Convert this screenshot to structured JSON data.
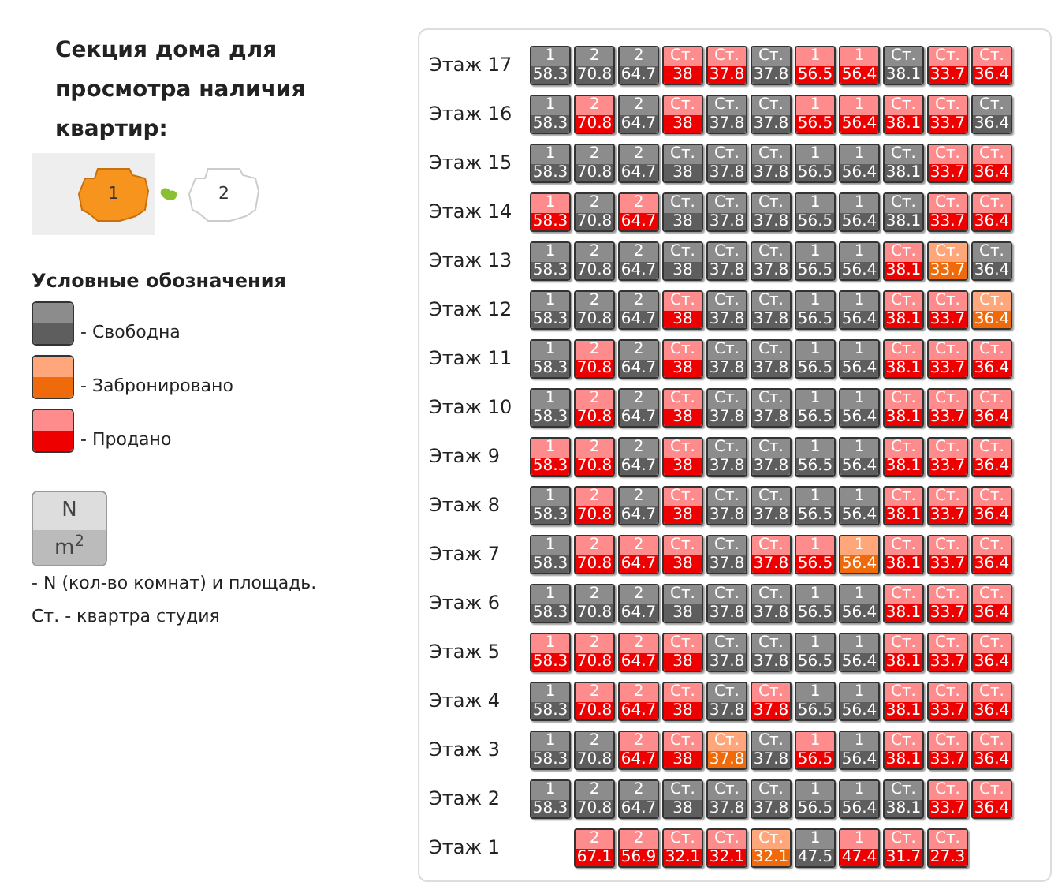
{
  "sidebar": {
    "title": "Секция дома для просмотра наличия квартир:",
    "sections": [
      {
        "label": "1",
        "selected": true
      },
      {
        "label": "2",
        "selected": false
      }
    ],
    "legend_title": "Условные обозначения",
    "legend": [
      {
        "kind": "free",
        "label": "- Свободна"
      },
      {
        "kind": "reserved",
        "label": "- Забронировано"
      },
      {
        "kind": "sold",
        "label": "- Продано"
      }
    ],
    "sample": {
      "top": "N",
      "bottom": "m$^{2}$",
      "label": "- N (кол-во комнат) и площадь."
    },
    "note": "Ст. - квартра студия"
  },
  "floors": [
    {
      "label": "Этаж 17",
      "indented": false,
      "cells": [
        {
          "rooms": "1",
          "area": "58.3",
          "kind": "free"
        },
        {
          "rooms": "2",
          "area": "70.8",
          "kind": "free"
        },
        {
          "rooms": "2",
          "area": "64.7",
          "kind": "free"
        },
        {
          "rooms": "Ст.",
          "area": "38",
          "kind": "sold"
        },
        {
          "rooms": "Ст.",
          "area": "37.8",
          "kind": "sold"
        },
        {
          "rooms": "Ст.",
          "area": "37.8",
          "kind": "free"
        },
        {
          "rooms": "1",
          "area": "56.5",
          "kind": "sold"
        },
        {
          "rooms": "1",
          "area": "56.4",
          "kind": "sold"
        },
        {
          "rooms": "Ст.",
          "area": "38.1",
          "kind": "free"
        },
        {
          "rooms": "Ст.",
          "area": "33.7",
          "kind": "sold"
        },
        {
          "rooms": "Ст.",
          "area": "36.4",
          "kind": "sold"
        }
      ]
    },
    {
      "label": "Этаж 16",
      "indented": false,
      "cells": [
        {
          "rooms": "1",
          "area": "58.3",
          "kind": "free"
        },
        {
          "rooms": "2",
          "area": "70.8",
          "kind": "sold"
        },
        {
          "rooms": "2",
          "area": "64.7",
          "kind": "free"
        },
        {
          "rooms": "Ст.",
          "area": "38",
          "kind": "sold"
        },
        {
          "rooms": "Ст.",
          "area": "37.8",
          "kind": "free"
        },
        {
          "rooms": "Ст.",
          "area": "37.8",
          "kind": "free"
        },
        {
          "rooms": "1",
          "area": "56.5",
          "kind": "sold"
        },
        {
          "rooms": "1",
          "area": "56.4",
          "kind": "sold"
        },
        {
          "rooms": "Ст.",
          "area": "38.1",
          "kind": "sold"
        },
        {
          "rooms": "Ст.",
          "area": "33.7",
          "kind": "sold"
        },
        {
          "rooms": "Ст.",
          "area": "36.4",
          "kind": "free"
        }
      ]
    },
    {
      "label": "Этаж 15",
      "indented": false,
      "cells": [
        {
          "rooms": "1",
          "area": "58.3",
          "kind": "free"
        },
        {
          "rooms": "2",
          "area": "70.8",
          "kind": "free"
        },
        {
          "rooms": "2",
          "area": "64.7",
          "kind": "free"
        },
        {
          "rooms": "Ст.",
          "area": "38",
          "kind": "free"
        },
        {
          "rooms": "Ст.",
          "area": "37.8",
          "kind": "free"
        },
        {
          "rooms": "Ст.",
          "area": "37.8",
          "kind": "free"
        },
        {
          "rooms": "1",
          "area": "56.5",
          "kind": "free"
        },
        {
          "rooms": "1",
          "area": "56.4",
          "kind": "free"
        },
        {
          "rooms": "Ст.",
          "area": "38.1",
          "kind": "free"
        },
        {
          "rooms": "Ст.",
          "area": "33.7",
          "kind": "sold"
        },
        {
          "rooms": "Ст.",
          "area": "36.4",
          "kind": "sold"
        }
      ]
    },
    {
      "label": "Этаж 14",
      "indented": false,
      "cells": [
        {
          "rooms": "1",
          "area": "58.3",
          "kind": "sold"
        },
        {
          "rooms": "2",
          "area": "70.8",
          "kind": "free"
        },
        {
          "rooms": "2",
          "area": "64.7",
          "kind": "sold"
        },
        {
          "rooms": "Ст.",
          "area": "38",
          "kind": "free"
        },
        {
          "rooms": "Ст.",
          "area": "37.8",
          "kind": "free"
        },
        {
          "rooms": "Ст.",
          "area": "37.8",
          "kind": "free"
        },
        {
          "rooms": "1",
          "area": "56.5",
          "kind": "free"
        },
        {
          "rooms": "1",
          "area": "56.4",
          "kind": "free"
        },
        {
          "rooms": "Ст.",
          "area": "38.1",
          "kind": "free"
        },
        {
          "rooms": "Ст.",
          "area": "33.7",
          "kind": "sold"
        },
        {
          "rooms": "Ст.",
          "area": "36.4",
          "kind": "sold"
        }
      ]
    },
    {
      "label": "Этаж 13",
      "indented": false,
      "cells": [
        {
          "rooms": "1",
          "area": "58.3",
          "kind": "free"
        },
        {
          "rooms": "2",
          "area": "70.8",
          "kind": "free"
        },
        {
          "rooms": "2",
          "area": "64.7",
          "kind": "free"
        },
        {
          "rooms": "Ст.",
          "area": "38",
          "kind": "free"
        },
        {
          "rooms": "Ст.",
          "area": "37.8",
          "kind": "free"
        },
        {
          "rooms": "Ст.",
          "area": "37.8",
          "kind": "free"
        },
        {
          "rooms": "1",
          "area": "56.5",
          "kind": "free"
        },
        {
          "rooms": "1",
          "area": "56.4",
          "kind": "free"
        },
        {
          "rooms": "Ст.",
          "area": "38.1",
          "kind": "sold"
        },
        {
          "rooms": "Ст.",
          "area": "33.7",
          "kind": "reserved"
        },
        {
          "rooms": "Ст.",
          "area": "36.4",
          "kind": "free"
        }
      ]
    },
    {
      "label": "Этаж 12",
      "indented": false,
      "cells": [
        {
          "rooms": "1",
          "area": "58.3",
          "kind": "free"
        },
        {
          "rooms": "2",
          "area": "70.8",
          "kind": "free"
        },
        {
          "rooms": "2",
          "area": "64.7",
          "kind": "free"
        },
        {
          "rooms": "Ст.",
          "area": "38",
          "kind": "sold"
        },
        {
          "rooms": "Ст.",
          "area": "37.8",
          "kind": "free"
        },
        {
          "rooms": "Ст.",
          "area": "37.8",
          "kind": "free"
        },
        {
          "rooms": "1",
          "area": "56.5",
          "kind": "free"
        },
        {
          "rooms": "1",
          "area": "56.4",
          "kind": "free"
        },
        {
          "rooms": "Ст.",
          "area": "38.1",
          "kind": "sold"
        },
        {
          "rooms": "Ст.",
          "area": "33.7",
          "kind": "sold"
        },
        {
          "rooms": "Ст.",
          "area": "36.4",
          "kind": "reserved"
        }
      ]
    },
    {
      "label": "Этаж 11",
      "indented": false,
      "cells": [
        {
          "rooms": "1",
          "area": "58.3",
          "kind": "free"
        },
        {
          "rooms": "2",
          "area": "70.8",
          "kind": "sold"
        },
        {
          "rooms": "2",
          "area": "64.7",
          "kind": "free"
        },
        {
          "rooms": "Ст.",
          "area": "38",
          "kind": "sold"
        },
        {
          "rooms": "Ст.",
          "area": "37.8",
          "kind": "free"
        },
        {
          "rooms": "Ст.",
          "area": "37.8",
          "kind": "free"
        },
        {
          "rooms": "1",
          "area": "56.5",
          "kind": "free"
        },
        {
          "rooms": "1",
          "area": "56.4",
          "kind": "free"
        },
        {
          "rooms": "Ст.",
          "area": "38.1",
          "kind": "sold"
        },
        {
          "rooms": "Ст.",
          "area": "33.7",
          "kind": "sold"
        },
        {
          "rooms": "Ст.",
          "area": "36.4",
          "kind": "sold"
        }
      ]
    },
    {
      "label": "Этаж 10",
      "indented": false,
      "cells": [
        {
          "rooms": "1",
          "area": "58.3",
          "kind": "free"
        },
        {
          "rooms": "2",
          "area": "70.8",
          "kind": "sold"
        },
        {
          "rooms": "2",
          "area": "64.7",
          "kind": "free"
        },
        {
          "rooms": "Ст.",
          "area": "38",
          "kind": "sold"
        },
        {
          "rooms": "Ст.",
          "area": "37.8",
          "kind": "free"
        },
        {
          "rooms": "Ст.",
          "area": "37.8",
          "kind": "free"
        },
        {
          "rooms": "1",
          "area": "56.5",
          "kind": "free"
        },
        {
          "rooms": "1",
          "area": "56.4",
          "kind": "free"
        },
        {
          "rooms": "Ст.",
          "area": "38.1",
          "kind": "sold"
        },
        {
          "rooms": "Ст.",
          "area": "33.7",
          "kind": "sold"
        },
        {
          "rooms": "Ст.",
          "area": "36.4",
          "kind": "sold"
        }
      ]
    },
    {
      "label": "Этаж 9",
      "indented": false,
      "cells": [
        {
          "rooms": "1",
          "area": "58.3",
          "kind": "sold"
        },
        {
          "rooms": "2",
          "area": "70.8",
          "kind": "sold"
        },
        {
          "rooms": "2",
          "area": "64.7",
          "kind": "free"
        },
        {
          "rooms": "Ст.",
          "area": "38",
          "kind": "sold"
        },
        {
          "rooms": "Ст.",
          "area": "37.8",
          "kind": "free"
        },
        {
          "rooms": "Ст.",
          "area": "37.8",
          "kind": "free"
        },
        {
          "rooms": "1",
          "area": "56.5",
          "kind": "free"
        },
        {
          "rooms": "1",
          "area": "56.4",
          "kind": "free"
        },
        {
          "rooms": "Ст.",
          "area": "38.1",
          "kind": "sold"
        },
        {
          "rooms": "Ст.",
          "area": "33.7",
          "kind": "sold"
        },
        {
          "rooms": "Ст.",
          "area": "36.4",
          "kind": "sold"
        }
      ]
    },
    {
      "label": "Этаж 8",
      "indented": false,
      "cells": [
        {
          "rooms": "1",
          "area": "58.3",
          "kind": "free"
        },
        {
          "rooms": "2",
          "area": "70.8",
          "kind": "sold"
        },
        {
          "rooms": "2",
          "area": "64.7",
          "kind": "free"
        },
        {
          "rooms": "Ст.",
          "area": "38",
          "kind": "sold"
        },
        {
          "rooms": "Ст.",
          "area": "37.8",
          "kind": "free"
        },
        {
          "rooms": "Ст.",
          "area": "37.8",
          "kind": "free"
        },
        {
          "rooms": "1",
          "area": "56.5",
          "kind": "free"
        },
        {
          "rooms": "1",
          "area": "56.4",
          "kind": "free"
        },
        {
          "rooms": "Ст.",
          "area": "38.1",
          "kind": "sold"
        },
        {
          "rooms": "Ст.",
          "area": "33.7",
          "kind": "sold"
        },
        {
          "rooms": "Ст.",
          "area": "36.4",
          "kind": "sold"
        }
      ]
    },
    {
      "label": "Этаж 7",
      "indented": false,
      "cells": [
        {
          "rooms": "1",
          "area": "58.3",
          "kind": "free"
        },
        {
          "rooms": "2",
          "area": "70.8",
          "kind": "sold"
        },
        {
          "rooms": "2",
          "area": "64.7",
          "kind": "sold"
        },
        {
          "rooms": "Ст.",
          "area": "38",
          "kind": "sold"
        },
        {
          "rooms": "Ст.",
          "area": "37.8",
          "kind": "free"
        },
        {
          "rooms": "Ст.",
          "area": "37.8",
          "kind": "sold"
        },
        {
          "rooms": "1",
          "area": "56.5",
          "kind": "sold"
        },
        {
          "rooms": "1",
          "area": "56.4",
          "kind": "reserved"
        },
        {
          "rooms": "Ст.",
          "area": "38.1",
          "kind": "sold"
        },
        {
          "rooms": "Ст.",
          "area": "33.7",
          "kind": "sold"
        },
        {
          "rooms": "Ст.",
          "area": "36.4",
          "kind": "sold"
        }
      ]
    },
    {
      "label": "Этаж 6",
      "indented": false,
      "cells": [
        {
          "rooms": "1",
          "area": "58.3",
          "kind": "free"
        },
        {
          "rooms": "2",
          "area": "70.8",
          "kind": "free"
        },
        {
          "rooms": "2",
          "area": "64.7",
          "kind": "free"
        },
        {
          "rooms": "Ст.",
          "area": "38",
          "kind": "free"
        },
        {
          "rooms": "Ст.",
          "area": "37.8",
          "kind": "free"
        },
        {
          "rooms": "Ст.",
          "area": "37.8",
          "kind": "free"
        },
        {
          "rooms": "1",
          "area": "56.5",
          "kind": "free"
        },
        {
          "rooms": "1",
          "area": "56.4",
          "kind": "free"
        },
        {
          "rooms": "Ст.",
          "area": "38.1",
          "kind": "sold"
        },
        {
          "rooms": "Ст.",
          "area": "33.7",
          "kind": "sold"
        },
        {
          "rooms": "Ст.",
          "area": "36.4",
          "kind": "sold"
        }
      ]
    },
    {
      "label": "Этаж 5",
      "indented": false,
      "cells": [
        {
          "rooms": "1",
          "area": "58.3",
          "kind": "sold"
        },
        {
          "rooms": "2",
          "area": "70.8",
          "kind": "sold"
        },
        {
          "rooms": "2",
          "area": "64.7",
          "kind": "sold"
        },
        {
          "rooms": "Ст.",
          "area": "38",
          "kind": "sold"
        },
        {
          "rooms": "Ст.",
          "area": "37.8",
          "kind": "free"
        },
        {
          "rooms": "Ст.",
          "area": "37.8",
          "kind": "free"
        },
        {
          "rooms": "1",
          "area": "56.5",
          "kind": "free"
        },
        {
          "rooms": "1",
          "area": "56.4",
          "kind": "free"
        },
        {
          "rooms": "Ст.",
          "area": "38.1",
          "kind": "sold"
        },
        {
          "rooms": "Ст.",
          "area": "33.7",
          "kind": "sold"
        },
        {
          "rooms": "Ст.",
          "area": "36.4",
          "kind": "sold"
        }
      ]
    },
    {
      "label": "Этаж 4",
      "indented": false,
      "cells": [
        {
          "rooms": "1",
          "area": "58.3",
          "kind": "free"
        },
        {
          "rooms": "2",
          "area": "70.8",
          "kind": "sold"
        },
        {
          "rooms": "2",
          "area": "64.7",
          "kind": "sold"
        },
        {
          "rooms": "Ст.",
          "area": "38",
          "kind": "sold"
        },
        {
          "rooms": "Ст.",
          "area": "37.8",
          "kind": "free"
        },
        {
          "rooms": "Ст.",
          "area": "37.8",
          "kind": "sold"
        },
        {
          "rooms": "1",
          "area": "56.5",
          "kind": "free"
        },
        {
          "rooms": "1",
          "area": "56.4",
          "kind": "free"
        },
        {
          "rooms": "Ст.",
          "area": "38.1",
          "kind": "sold"
        },
        {
          "rooms": "Ст.",
          "area": "33.7",
          "kind": "sold"
        },
        {
          "rooms": "Ст.",
          "area": "36.4",
          "kind": "sold"
        }
      ]
    },
    {
      "label": "Этаж 3",
      "indented": false,
      "cells": [
        {
          "rooms": "1",
          "area": "58.3",
          "kind": "free"
        },
        {
          "rooms": "2",
          "area": "70.8",
          "kind": "free"
        },
        {
          "rooms": "2",
          "area": "64.7",
          "kind": "sold"
        },
        {
          "rooms": "Ст.",
          "area": "38",
          "kind": "sold"
        },
        {
          "rooms": "Ст.",
          "area": "37.8",
          "kind": "reserved"
        },
        {
          "rooms": "Ст.",
          "area": "37.8",
          "kind": "free"
        },
        {
          "rooms": "1",
          "area": "56.5",
          "kind": "sold"
        },
        {
          "rooms": "1",
          "area": "56.4",
          "kind": "free"
        },
        {
          "rooms": "Ст.",
          "area": "38.1",
          "kind": "sold"
        },
        {
          "rooms": "Ст.",
          "area": "33.7",
          "kind": "sold"
        },
        {
          "rooms": "Ст.",
          "area": "36.4",
          "kind": "sold"
        }
      ]
    },
    {
      "label": "Этаж 2",
      "indented": false,
      "cells": [
        {
          "rooms": "1",
          "area": "58.3",
          "kind": "free"
        },
        {
          "rooms": "2",
          "area": "70.8",
          "kind": "free"
        },
        {
          "rooms": "2",
          "area": "64.7",
          "kind": "free"
        },
        {
          "rooms": "Ст.",
          "area": "38",
          "kind": "free"
        },
        {
          "rooms": "Ст.",
          "area": "37.8",
          "kind": "free"
        },
        {
          "rooms": "Ст.",
          "area": "37.8",
          "kind": "free"
        },
        {
          "rooms": "1",
          "area": "56.5",
          "kind": "free"
        },
        {
          "rooms": "1",
          "area": "56.4",
          "kind": "free"
        },
        {
          "rooms": "Ст.",
          "area": "38.1",
          "kind": "free"
        },
        {
          "rooms": "Ст.",
          "area": "33.7",
          "kind": "sold"
        },
        {
          "rooms": "Ст.",
          "area": "36.4",
          "kind": "sold"
        }
      ]
    },
    {
      "label": "Этаж 1",
      "indented": true,
      "cells": [
        {
          "rooms": "2",
          "area": "67.1",
          "kind": "sold"
        },
        {
          "rooms": "2",
          "area": "56.9",
          "kind": "sold"
        },
        {
          "rooms": "Ст.",
          "area": "32.1",
          "kind": "sold"
        },
        {
          "rooms": "Ст.",
          "area": "32.1",
          "kind": "sold"
        },
        {
          "rooms": "Ст.",
          "area": "32.1",
          "kind": "reserved"
        },
        {
          "rooms": "1",
          "area": "47.5",
          "kind": "free"
        },
        {
          "rooms": "1",
          "area": "47.4",
          "kind": "sold"
        },
        {
          "rooms": "Ст.",
          "area": "31.7",
          "kind": "sold"
        },
        {
          "rooms": "Ст.",
          "area": "27.3",
          "kind": "sold"
        }
      ]
    }
  ]
}
